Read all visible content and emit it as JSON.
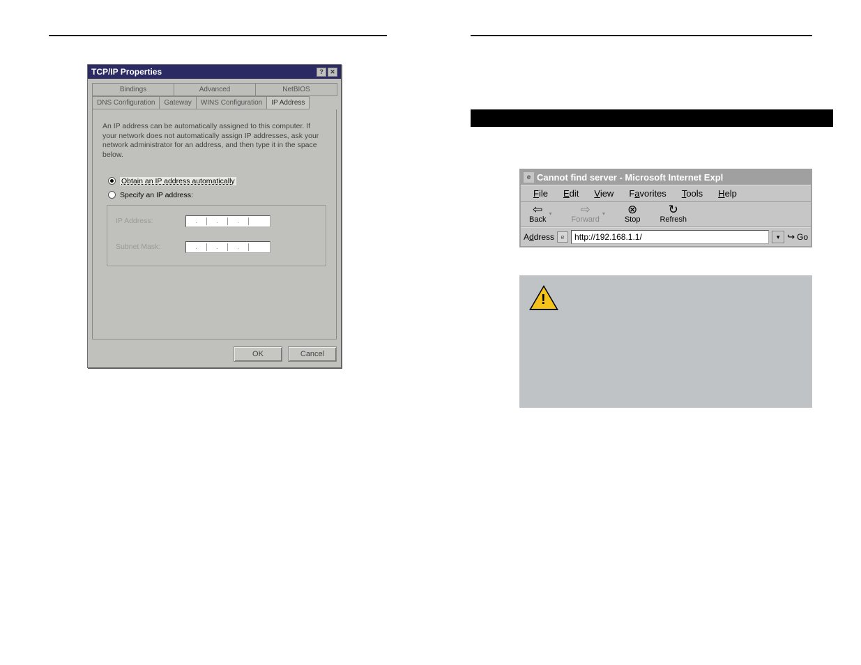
{
  "dialog": {
    "title": "TCP/IP Properties",
    "help_btn": "?",
    "close_btn": "✕",
    "tabs_top": [
      "Bindings",
      "Advanced",
      "NetBIOS"
    ],
    "tabs_bottom": [
      "DNS Configuration",
      "Gateway",
      "WINS Configuration",
      "IP Address"
    ],
    "active_tab": "IP Address",
    "description": "An IP address can be automatically assigned to this computer. If your network does not automatically assign IP addresses, ask your network administrator for an address, and then type it in the space below.",
    "radio_auto": "Obtain an IP address automatically",
    "radio_specify": "Specify an IP address:",
    "field_ip": "IP Address:",
    "field_mask": "Subnet Mask:",
    "ok": "OK",
    "cancel": "Cancel"
  },
  "ie": {
    "title": "Cannot find server - Microsoft Internet Expl",
    "menu": {
      "file": "File",
      "edit": "Edit",
      "view": "View",
      "favorites": "Favorites",
      "tools": "Tools",
      "help": "Help"
    },
    "toolbar": {
      "back": "Back",
      "forward": "Forward",
      "stop": "Stop",
      "refresh": "Refresh"
    },
    "address_label": "Address",
    "address_value": "http://192.168.1.1/",
    "go": "Go"
  }
}
